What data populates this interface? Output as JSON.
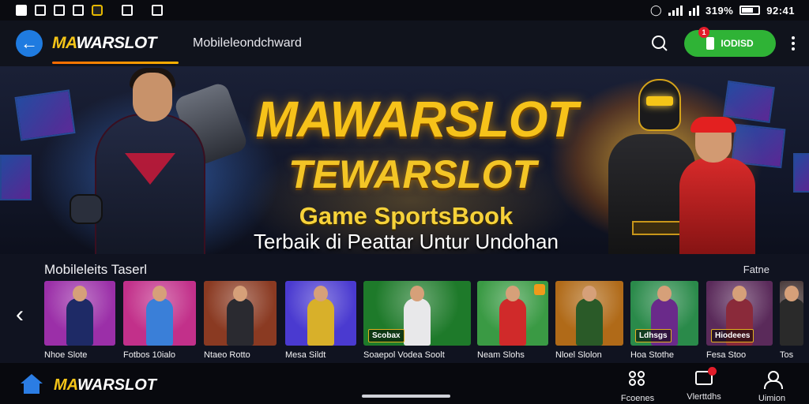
{
  "statusbar": {
    "battery_text": "319%",
    "time": "92:41",
    "icons": [
      "notification-icon",
      "gallery-icon",
      "app-icon",
      "vpn-icon",
      "media-icon",
      "edit-icon",
      "alarm-icon",
      "signal-icon",
      "battery-icon"
    ]
  },
  "header": {
    "logo_prefix": "MA",
    "logo_rest": "WARSLOT",
    "subtitle": "Mobileleondchward",
    "download_label": "IODISD",
    "badge_count": "1",
    "colors": {
      "accent_gold": "#f5c518",
      "download_green": "#2fb336",
      "back_blue": "#1f7be0"
    }
  },
  "hero": {
    "title1": "MAWARSLOT",
    "title2": "TEWARSLOT",
    "title3": "Game SportsBook",
    "title4": "Terbaik di Peattar Untur Undohan"
  },
  "categories": {
    "title": "Mobileleits Taserl",
    "more": "Fatne",
    "games": [
      {
        "label": "Nhoe Slote",
        "bg": "#9b2fa8",
        "fig": "#1e2a66"
      },
      {
        "label": "Fotbos 10ialo",
        "bg": "#c2308a",
        "fig": "#3a7fd8"
      },
      {
        "label": "Ntaeo Rotto",
        "bg": "#8a3a22",
        "fig": "#2a2a30"
      },
      {
        "label": "Mesa Sildt",
        "bg": "#4a3ad0",
        "fig": "#d8b02a"
      },
      {
        "label": "Soaepol Vodea Soolt",
        "bg": "#1e7a2a",
        "fig": "#e8e8ea",
        "caption": "Scobax"
      },
      {
        "label": "Neam Slohs",
        "bg": "#3a9a44",
        "fig": "#d02a2a"
      },
      {
        "label": "Nloel Slolon",
        "bg": "#b06a18",
        "fig": "#2a5a28"
      },
      {
        "label": "Hoa Stothe",
        "bg": "#2a8a4a",
        "fig": "#6a2a8a",
        "caption": "Ldhsgs"
      },
      {
        "label": "Fesa Stoo",
        "bg": "#5a2a5a",
        "fig": "#8a2a3a",
        "caption": "Hiodeees"
      },
      {
        "label": "Tos",
        "bg": "#3a2a2a",
        "fig": "#2a2a2a"
      }
    ]
  },
  "bottomnav": {
    "logo_prefix": "MA",
    "logo_rest": "WARSLOT",
    "items": [
      {
        "label": "Fcoenes"
      },
      {
        "label": "Vlerttdhs"
      },
      {
        "label": "Uimion"
      }
    ]
  }
}
